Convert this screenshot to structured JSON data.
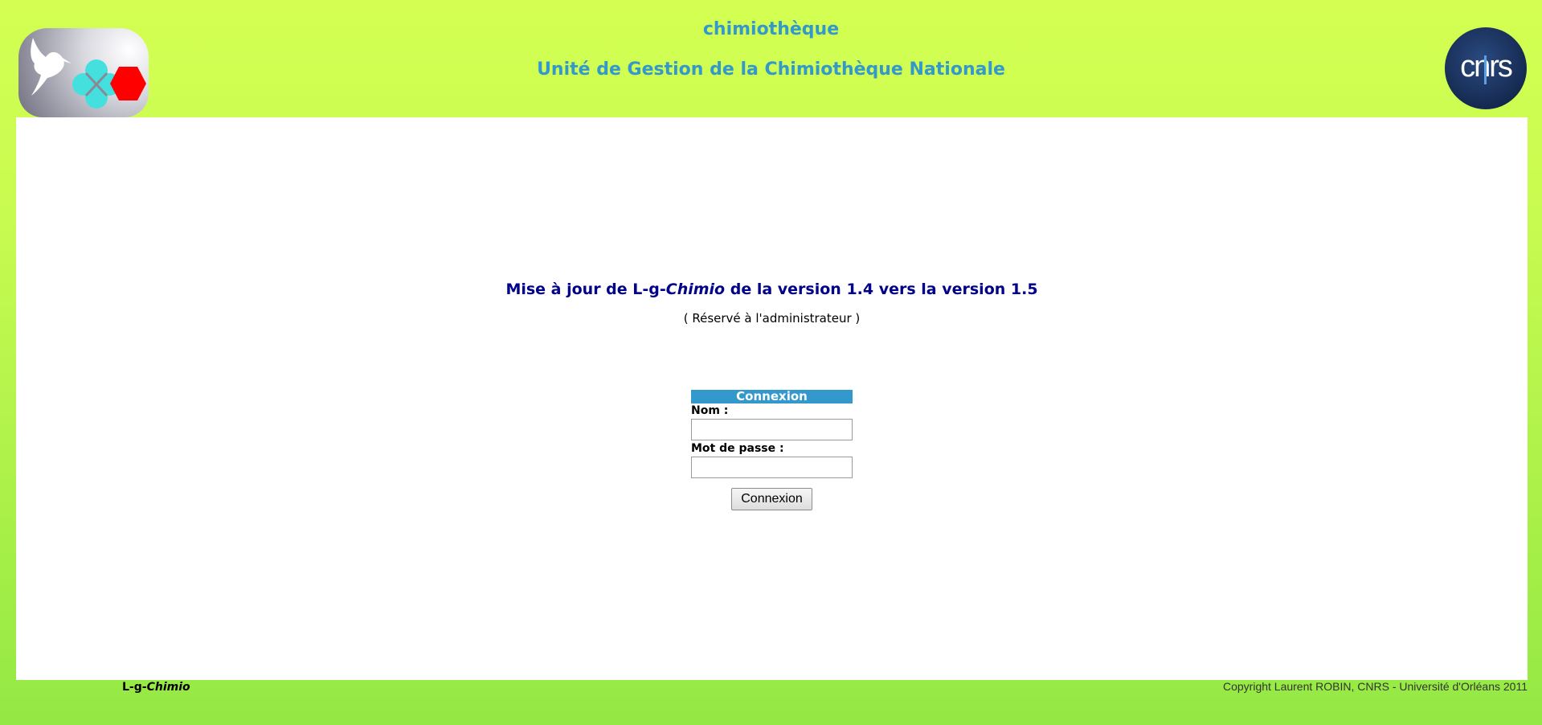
{
  "header": {
    "title": "chimiothèque",
    "subtitle": "Unité de Gestion de la Chimiothèque Nationale",
    "logo_left_icon": "hummingbird-molecule-logo",
    "logo_right_icon": "cnrs-logo",
    "cnrs_text": "cnrs"
  },
  "main": {
    "update_title_prefix": "Mise à jour de L-g-",
    "update_title_italic": "Chimio",
    "update_title_suffix": " de la version 1.4 vers la version 1.5",
    "reserved_note": "( Réservé à l'administrateur )"
  },
  "login": {
    "header": "Connexion",
    "name_label": "Nom :",
    "name_value": "",
    "password_label": "Mot de passe :",
    "password_value": "",
    "submit_label": "Connexion"
  },
  "footer": {
    "app_prefix": "L-g-",
    "app_italic": "Chimio",
    "copyright": "Copyright Laurent ROBIN, CNRS - Université d'Orléans 2011"
  },
  "colors": {
    "accent": "#3399cc",
    "title_dark": "#000088",
    "background_top": "#d4ff52",
    "background_bottom": "#94e844"
  }
}
